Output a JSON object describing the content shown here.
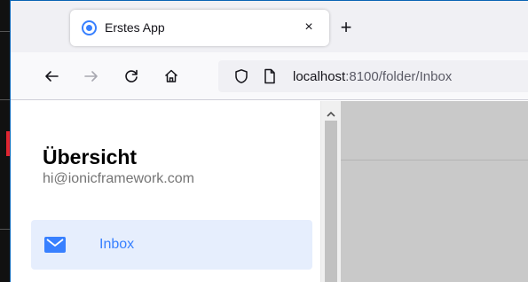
{
  "browser": {
    "tab": {
      "title": "Erstes App",
      "close_glyph": "×"
    },
    "new_tab_glyph": "+",
    "url": {
      "host": "localhost",
      "rest": ":8100/folder/Inbox"
    },
    "icons": [
      "back-icon",
      "forward-icon",
      "reload-icon",
      "home-icon",
      "shield-icon",
      "page-icon"
    ]
  },
  "menu": {
    "title": "Übersicht",
    "subtitle": "hi@ionicframework.com",
    "items": [
      {
        "label": "Inbox",
        "icon": "mail-icon",
        "selected": true
      }
    ]
  },
  "colors": {
    "accent": "#3880ff",
    "selected_bg": "#e6eefd",
    "backdrop": "#c9c9c9",
    "window_border": "#0a64b4"
  }
}
